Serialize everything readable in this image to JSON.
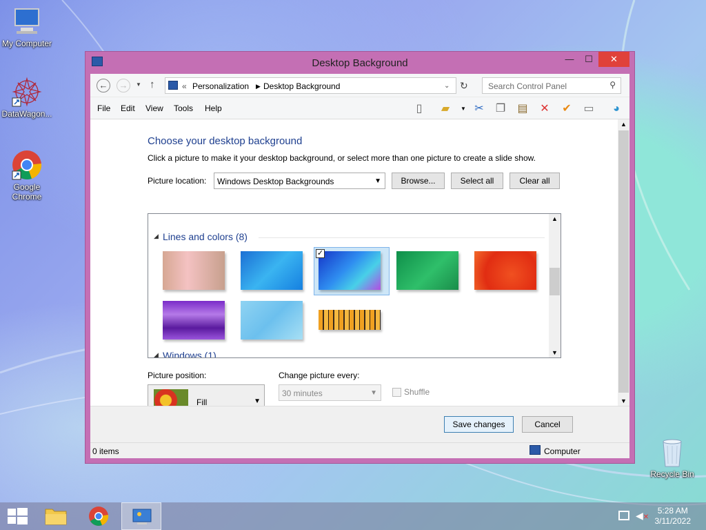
{
  "desktop": {
    "icons": [
      {
        "label": "My Computer",
        "icon": "computer-icon"
      },
      {
        "label": "DataWagon...",
        "icon": "datawagon-icon"
      },
      {
        "label": "Google Chrome",
        "icon": "chrome-icon"
      },
      {
        "label": "Recycle Bin",
        "icon": "recycle-bin-icon"
      }
    ]
  },
  "window": {
    "title": "Desktop Background",
    "controls": {
      "minimize": "—",
      "maximize": "☐",
      "close": "✕"
    },
    "address": {
      "prefix": "«",
      "crumbs": [
        "Personalization",
        "Desktop Background"
      ]
    },
    "search_placeholder": "Search Control Panel",
    "menu": [
      "File",
      "Edit",
      "View",
      "Tools",
      "Help"
    ],
    "heading": "Choose your desktop background",
    "description": "Click a picture to make it your desktop background, or select more than one picture to create a slide show.",
    "picture_location_label": "Picture location:",
    "picture_location_value": "Windows Desktop Backgrounds",
    "browse_label": "Browse...",
    "select_all_label": "Select all",
    "clear_all_label": "Clear all",
    "group1": "Lines and colors (8)",
    "group2": "Windows (1)",
    "picture_position_label": "Picture position:",
    "picture_position_value": "Fill",
    "change_picture_label": "Change picture every:",
    "change_picture_value": "30 minutes",
    "shuffle_label": "Shuffle",
    "save_label": "Save changes",
    "cancel_label": "Cancel",
    "status_items": "0 items",
    "status_location": "Computer"
  },
  "thumbnails": [
    {
      "name": "pink-cartoon",
      "selected": false
    },
    {
      "name": "blue-lines",
      "selected": false
    },
    {
      "name": "blue-petals",
      "selected": true
    },
    {
      "name": "green-ribbon",
      "selected": false
    },
    {
      "name": "orange-swirl",
      "selected": false
    },
    {
      "name": "purple-waves",
      "selected": false
    },
    {
      "name": "light-blue-lines",
      "selected": false
    },
    {
      "name": "orange-stripes",
      "selected": false
    }
  ],
  "taskbar": {
    "time": "5:28 AM",
    "date": "3/11/2022"
  },
  "colors": {
    "window_frame": "#c46fb4",
    "close_button": "#e0413a",
    "accent_text": "#1e3f8f"
  }
}
